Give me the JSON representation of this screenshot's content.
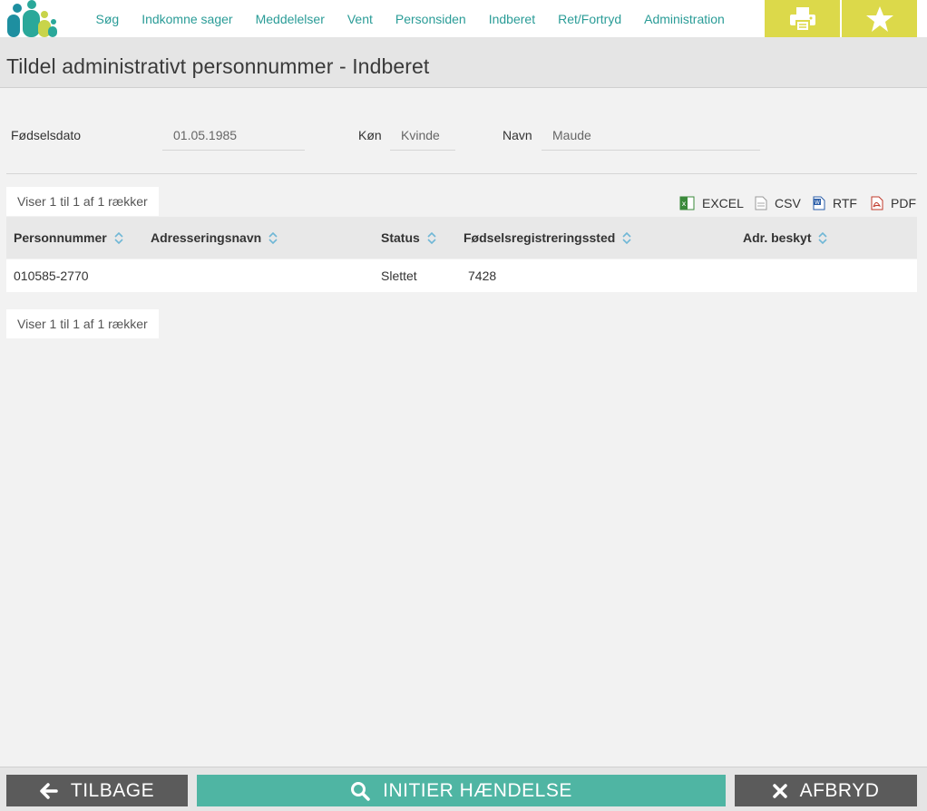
{
  "nav": {
    "items": [
      "Søg",
      "Indkomne sager",
      "Meddelelser",
      "Vent",
      "Personsiden",
      "Indberet",
      "Ret/Fortryd",
      "Administration"
    ]
  },
  "toolbar": {
    "print_icon": "print-icon",
    "favorite_icon": "star-icon",
    "accent_color": "#dcd94a"
  },
  "page": {
    "title": "Tildel administrativt personnummer - Indberet"
  },
  "filters": {
    "birthdate_label": "Fødselsdato",
    "birthdate_value": "01.05.1985",
    "gender_label": "Køn",
    "gender_value": "Kvinde",
    "name_label": "Navn",
    "name_value": "Maude"
  },
  "table": {
    "info_top": "Viser 1 til 1 af 1 rækker",
    "info_bottom": "Viser 1 til 1 af 1 rækker",
    "exports": [
      "EXCEL",
      "CSV",
      "RTF",
      "PDF"
    ],
    "columns": [
      "Personnummer",
      "Adresseringsnavn",
      "Status",
      "Fødselsregistreringssted",
      "Adr. beskyt"
    ],
    "rows": [
      [
        "010585-2770",
        "",
        "Slettet",
        "7428",
        ""
      ]
    ]
  },
  "footer": {
    "back_label": "TILBAGE",
    "init_label": "INITIER HÆNDELSE",
    "cancel_label": "AFBRYD",
    "primary_color": "#4fb5a3",
    "secondary_color": "#5b5b5b"
  }
}
